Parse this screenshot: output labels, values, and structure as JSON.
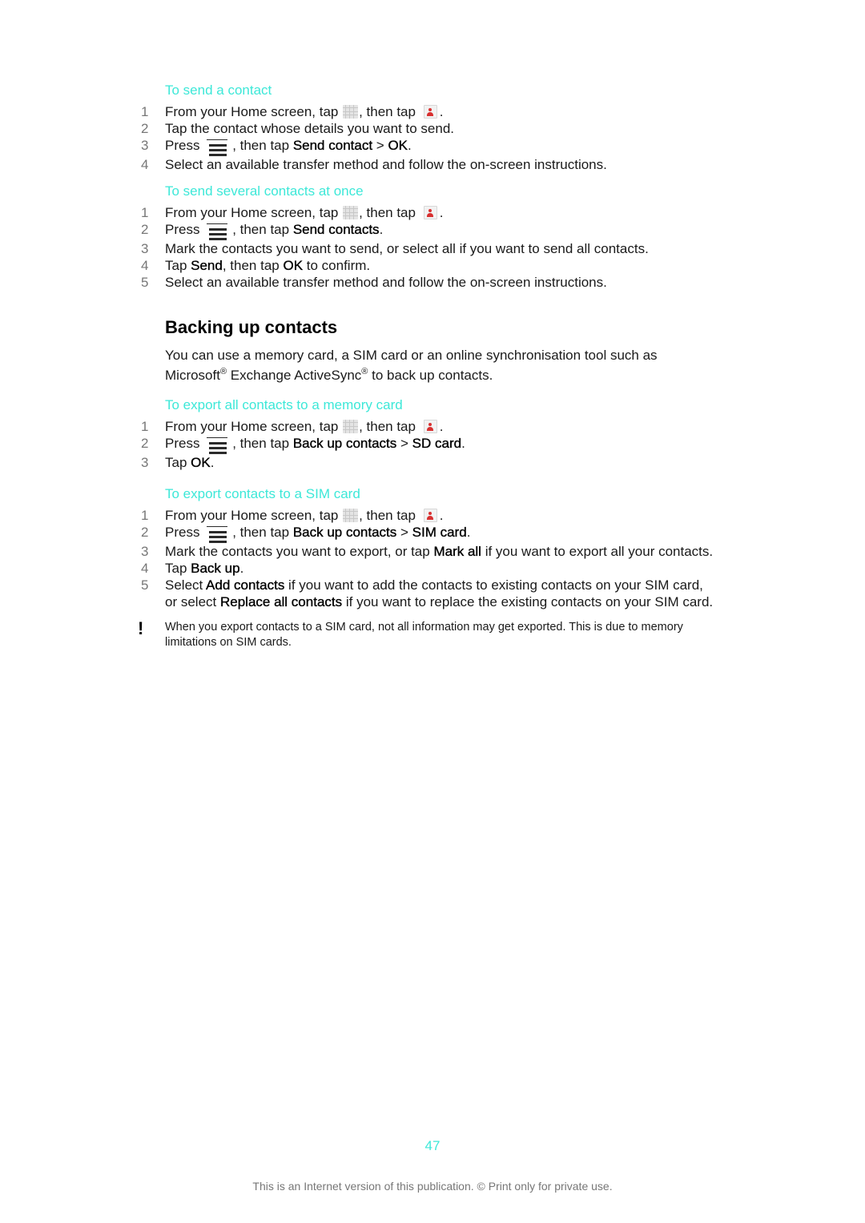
{
  "sections": {
    "send_contact": {
      "heading": "To send a contact",
      "steps": [
        {
          "num": "1",
          "parts": [
            "From your Home screen, tap ",
            "apps-icon",
            ", then tap ",
            "contacts-icon",
            "."
          ]
        },
        {
          "num": "2",
          "text": "Tap the contact whose details you want to send."
        },
        {
          "num": "3",
          "parts": [
            "Press ",
            "menu-icon",
            ", then tap ",
            {
              "b": "Send contact"
            },
            " > ",
            {
              "b": "OK"
            },
            "."
          ]
        },
        {
          "num": "4",
          "text": "Select an available transfer method and follow the on-screen instructions."
        }
      ]
    },
    "send_several": {
      "heading": "To send several contacts at once",
      "steps": [
        {
          "num": "1",
          "parts": [
            "From your Home screen, tap ",
            "apps-icon",
            ", then tap ",
            "contacts-icon",
            "."
          ]
        },
        {
          "num": "2",
          "parts": [
            "Press ",
            "menu-icon",
            ", then tap ",
            {
              "b": "Send contacts"
            },
            "."
          ]
        },
        {
          "num": "3",
          "text": "Mark the contacts you want to send, or select all if you want to send all contacts."
        },
        {
          "num": "4",
          "parts": [
            "Tap ",
            {
              "b": "Send"
            },
            ", then tap ",
            {
              "b": "OK"
            },
            " to confirm."
          ]
        },
        {
          "num": "5",
          "text": "Select an available transfer method and follow the on-screen instructions."
        }
      ]
    },
    "backing_up": {
      "title": "Backing up contacts",
      "intro_parts": [
        "You can use a memory card, a SIM card or an online synchronisation tool such as Microsoft",
        {
          "sup": "®"
        },
        " Exchange ActiveSync",
        {
          "sup": "®"
        },
        " to back up contacts."
      ]
    },
    "export_memory": {
      "heading": "To export all contacts to a memory card",
      "steps": [
        {
          "num": "1",
          "parts": [
            "From your Home screen, tap ",
            "apps-icon",
            ", then tap ",
            "contacts-icon",
            "."
          ]
        },
        {
          "num": "2",
          "parts": [
            "Press ",
            "menu-icon",
            ", then tap ",
            {
              "b": "Back up contacts"
            },
            " > ",
            {
              "b": "SD card"
            },
            "."
          ]
        },
        {
          "num": "3",
          "parts": [
            "Tap ",
            {
              "b": "OK"
            },
            "."
          ]
        }
      ]
    },
    "export_sim": {
      "heading": "To export contacts to a SIM card",
      "steps": [
        {
          "num": "1",
          "parts": [
            "From your Home screen, tap ",
            "apps-icon",
            ", then tap ",
            "contacts-icon",
            "."
          ]
        },
        {
          "num": "2",
          "parts": [
            "Press ",
            "menu-icon",
            ", then tap ",
            {
              "b": "Back up contacts"
            },
            " > ",
            {
              "b": "SIM card"
            },
            "."
          ]
        },
        {
          "num": "3",
          "parts": [
            "Mark the contacts you want to export, or tap ",
            {
              "b": "Mark all"
            },
            " if you want to export all your contacts."
          ]
        },
        {
          "num": "4",
          "parts": [
            "Tap ",
            {
              "b": "Back up"
            },
            "."
          ]
        },
        {
          "num": "5",
          "parts": [
            "Select ",
            {
              "b": "Add contacts"
            },
            " if you want to add the contacts to existing contacts on your SIM card, or select ",
            {
              "b": "Replace all contacts"
            },
            " if you want to replace the existing contacts on your SIM card."
          ]
        }
      ],
      "note": {
        "icon": "!",
        "text": "When you export contacts to a SIM card, not all information may get exported. This is due to memory limitations on SIM cards."
      }
    }
  },
  "page_number": "47",
  "footer": "This is an Internet version of this publication. © Print only for private use.",
  "colors": {
    "accent": "#3de8d8",
    "step_number": "#777777",
    "footer": "#777777"
  }
}
